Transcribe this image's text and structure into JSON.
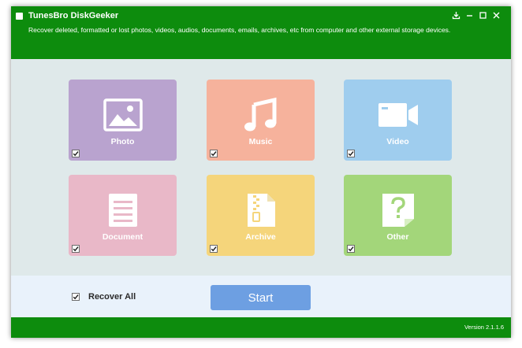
{
  "app": {
    "title": "TunesBro DiskGeeker",
    "subtitle": "Recover deleted, formatted or lost photos, videos, audios, documents, emails, archives, etc from computer and other external storage devices.",
    "window_controls": [
      "download-icon",
      "minimize-icon",
      "maximize-icon",
      "close-icon"
    ]
  },
  "tiles": [
    {
      "label": "Photo",
      "icon": "photo-icon",
      "color": "#b9a3cf",
      "checked": true
    },
    {
      "label": "Music",
      "icon": "music-icon",
      "color": "#f6b29c",
      "checked": true
    },
    {
      "label": "Video",
      "icon": "video-icon",
      "color": "#9fcdee",
      "checked": true
    },
    {
      "label": "Document",
      "icon": "document-icon",
      "color": "#e9b8c8",
      "checked": true
    },
    {
      "label": "Archive",
      "icon": "archive-icon",
      "color": "#f5d57b",
      "checked": true
    },
    {
      "label": "Other",
      "icon": "other-icon",
      "color": "#a3d67a",
      "checked": true
    }
  ],
  "footer": {
    "recover_all_label": "Recover All",
    "recover_all_checked": true,
    "start_label": "Start"
  },
  "status": {
    "version": "Version 2.1.1.6"
  },
  "colors": {
    "titlebar": "#0d8c0d",
    "background": "#dfe9ea",
    "start_button": "#6d9fe2"
  }
}
